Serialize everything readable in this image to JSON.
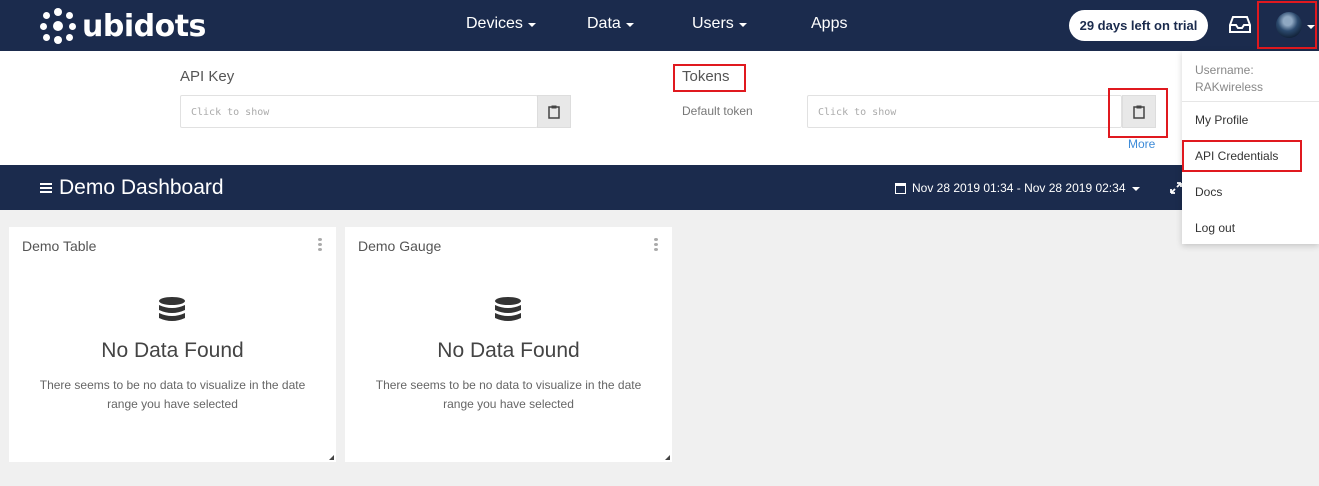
{
  "brand": {
    "name": "ubidots",
    "logo_icon": "ubidots-dots-logo"
  },
  "nav": {
    "items": [
      {
        "label": "Devices",
        "dropdown": true
      },
      {
        "label": "Data",
        "dropdown": true
      },
      {
        "label": "Users",
        "dropdown": true
      },
      {
        "label": "Apps",
        "dropdown": false
      }
    ],
    "trial_badge": "29 days left on trial",
    "inbox_icon": "inbox-icon",
    "avatar_icon": "user-avatar"
  },
  "credentials": {
    "api_key_label": "API Key",
    "api_key_placeholder": "Click to show",
    "tokens_label": "Tokens",
    "default_token_label": "Default token",
    "default_token_placeholder": "Click to show",
    "copy_icon": "clipboard-icon",
    "more_link": "More"
  },
  "dashboard": {
    "title": "Demo Dashboard",
    "date_range": "Nov 28 2019 01:34 - Nov 28 2019 02:34",
    "widgets": [
      {
        "title": "Demo Table",
        "empty_title": "No Data Found",
        "empty_desc": "There seems to be no data to visualize in the date range you have selected"
      },
      {
        "title": "Demo Gauge",
        "empty_title": "No Data Found",
        "empty_desc": "There seems to be no data to visualize in the date range you have selected"
      }
    ]
  },
  "user_menu": {
    "username_label": "Username:",
    "username": "RAKwireless",
    "items": [
      "My Profile",
      "API Credentials",
      "Docs",
      "Log out"
    ]
  },
  "colors": {
    "navy": "#1b2b4d",
    "highlight_red": "#e0191f",
    "link_blue": "#3d8bd8",
    "background": "#f0f0f0"
  }
}
